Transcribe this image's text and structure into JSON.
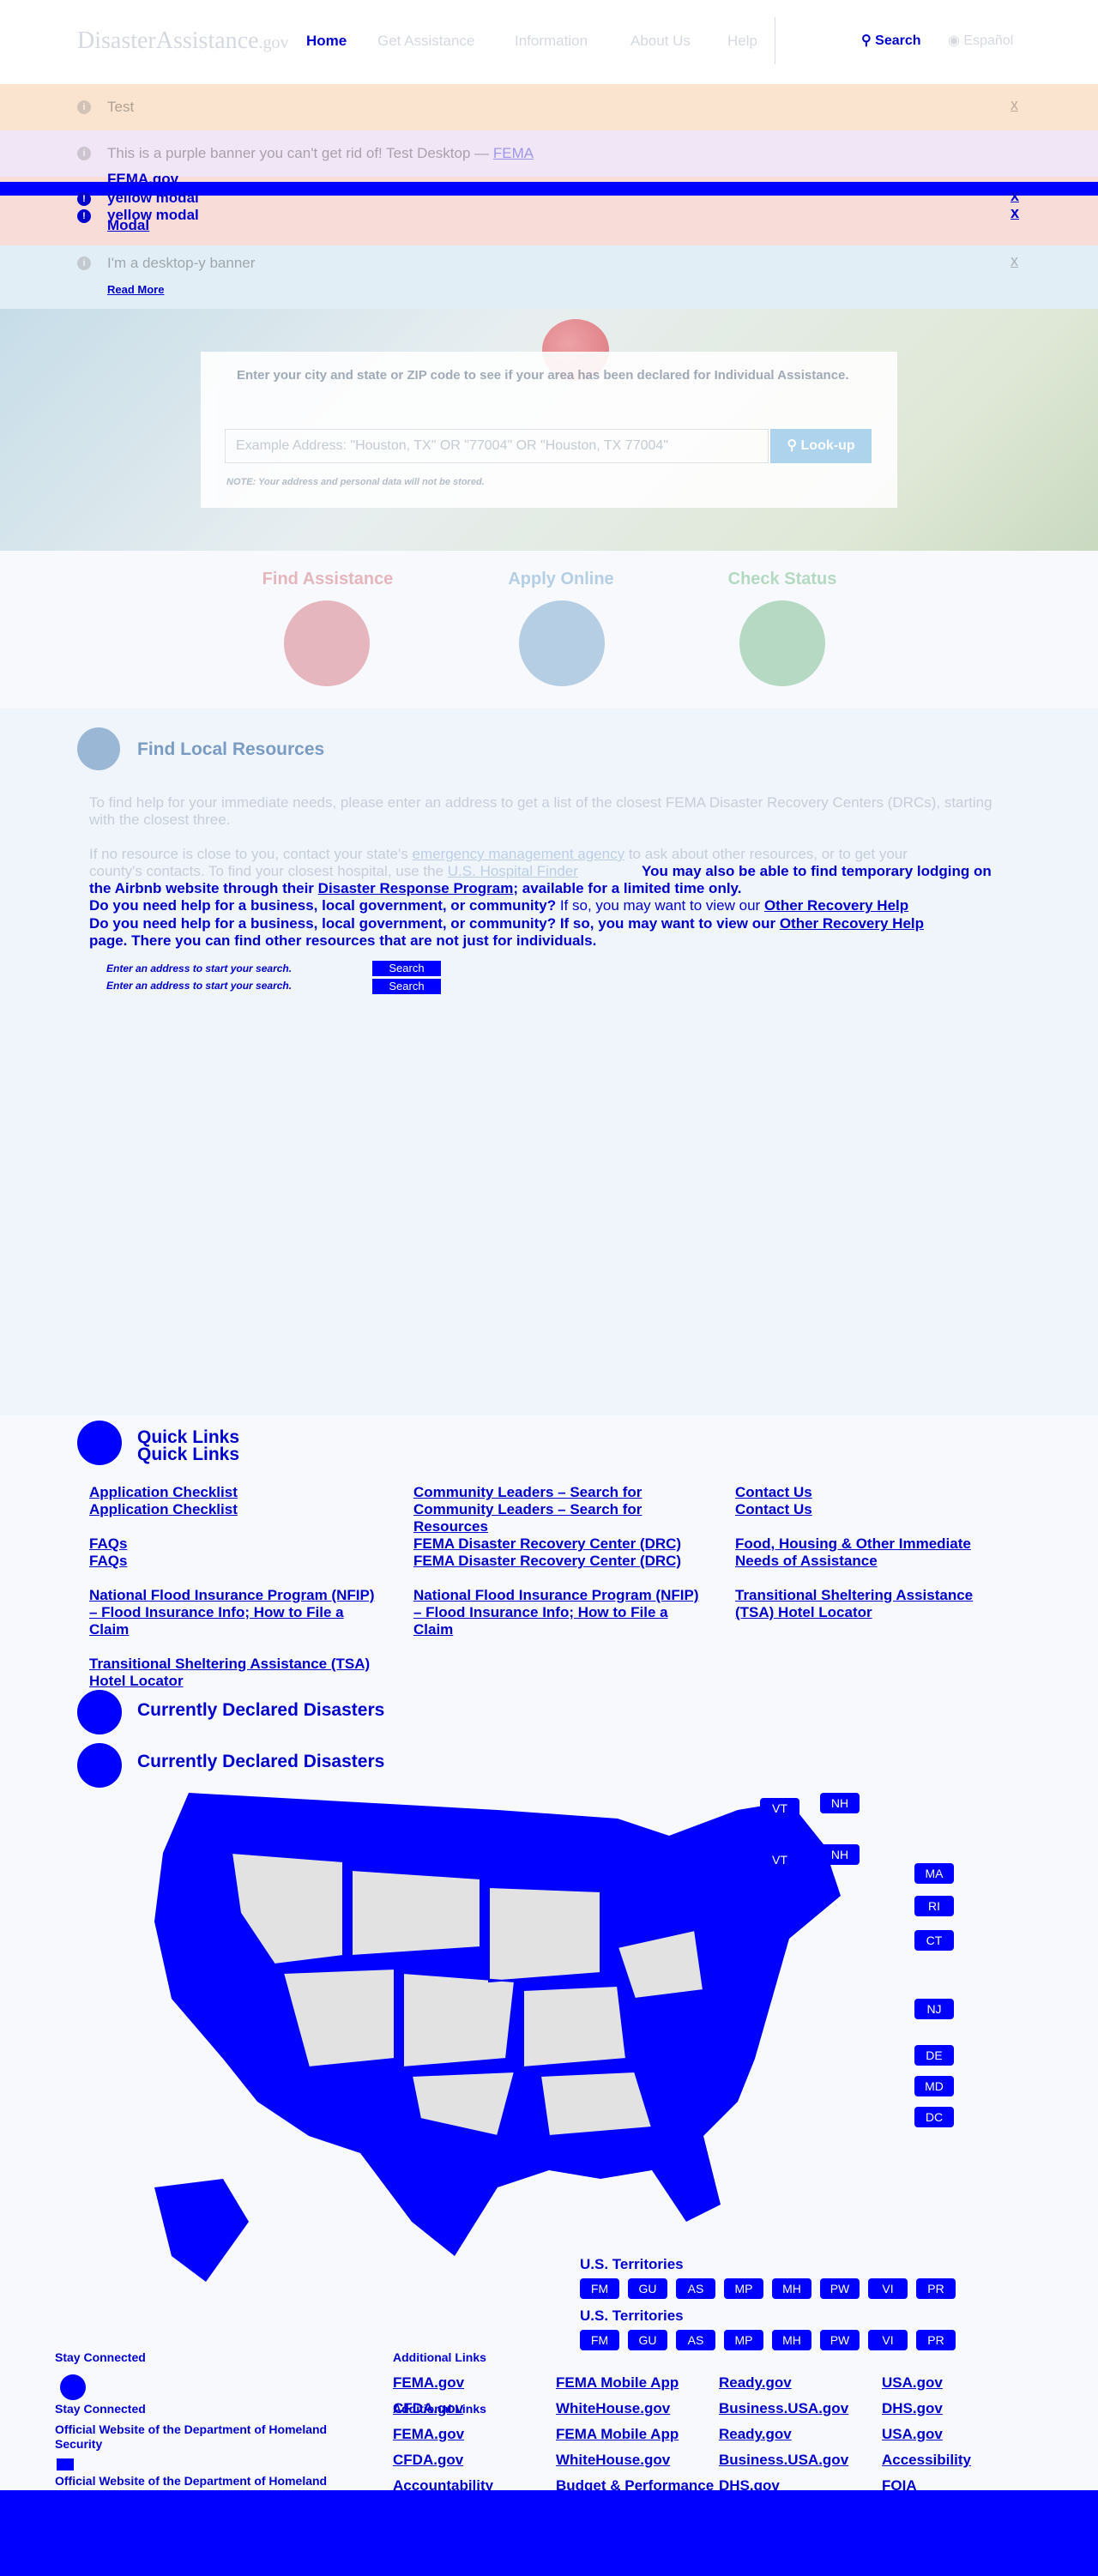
{
  "header": {
    "logo_main": "DisasterAssistance",
    "logo_gov": ".gov",
    "nav": [
      "Home",
      "Get Assistance",
      "Information",
      "About Us",
      "Help"
    ],
    "search": "Search",
    "espanol": "Español"
  },
  "banners": [
    {
      "text": "Test",
      "close": "x"
    },
    {
      "text": "This is a purple banner you can't get rid of! Test Desktop",
      "link": "FEMA"
    },
    {
      "text": "yellow modal",
      "close": "x"
    },
    {
      "text": "I'm a desktop-y banner",
      "close": "x"
    }
  ],
  "overlay": {
    "fema_gov": "FEMA.gov",
    "yellow_modal_1": "yellow modal",
    "yellow_modal_2": "yellow modal",
    "modal": "Modal",
    "x1": "x",
    "x2": "x",
    "read_more": "Read More"
  },
  "hero": {
    "prompt": "Enter your city and state or ZIP code to see if your area has been declared for Individual Assistance.",
    "placeholder": "Example Address: \"Houston, TX\" OR \"77004\" OR \"Houston, TX 77004\"",
    "button": "Look-up",
    "note": "NOTE: Your address and personal data will not be stored."
  },
  "actions": {
    "find": "Find Assistance",
    "apply": "Apply Online",
    "status": "Check Status"
  },
  "local": {
    "title": "Find Local Resources",
    "p1": "To find help for your immediate needs, please enter an address to get a list of the closest FEMA Disaster Recovery Centers (DRCs), starting with the closest three.",
    "p2_a": "If no resource is close to you, contact your state's",
    "p2_link": "emergency management agency",
    "p2_b": "to ask about other resources, or to get your",
    "p3_a": "county's contacts. To find your closest hospital, use the",
    "p3_link": "U.S. Hospital Finder",
    "p3_b": "You may also be able to find temporary lodging on",
    "p4_a": "the Airbnb website through their",
    "p4_link": "Disaster Response Program",
    "p4_b": "; available for a limited time only.",
    "p5_a": "Do you need help for a business, local government, or community?",
    "p5_b": "If so, you may want to view our",
    "p5_link": "Other Recovery Help",
    "p6_a": "Do you need help for a business, local government, or community? If so, you may want to view our",
    "p6_link": "Other Recovery Help",
    "p7": "page. There you can find other resources that are not just for individuals.",
    "search_hint_1": "Enter an address to start your search.",
    "search_hint_2": "Enter an address to start your search.",
    "search_btn_1": "Search",
    "search_btn_2": "Search"
  },
  "quick_links": {
    "title_1": "Quick Links",
    "title_2": "Quick Links",
    "col1": [
      "Application Checklist",
      "Application Checklist",
      "FAQs",
      "FAQs",
      "National Flood Insurance Program (NFIP) – Flood Insurance Info; How to File a Claim",
      "Transitional Sheltering Assistance (TSA) Hotel Locator"
    ],
    "col2": [
      "Community Leaders – Search for Community Leaders – Search for Resources",
      "FEMA Disaster Recovery Center (DRC)",
      "FEMA Disaster Recovery Center (DRC)",
      "National Flood Insurance Program (NFIP) – Flood Insurance Info; How to File a Claim"
    ],
    "col3": [
      "Contact Us",
      "Contact Us",
      "Food, Housing & Other Immediate Needs of Assistance",
      "Transitional Sheltering Assistance (TSA) Hotel Locator"
    ]
  },
  "declared": {
    "title_1": "Currently Declared Disasters",
    "title_2": "Currently Declared Disasters",
    "small_states": [
      "VT",
      "NH",
      "VT",
      "NH",
      "MA",
      "RI",
      "CT",
      "NJ",
      "DE",
      "MD",
      "DC"
    ],
    "territories_title_1": "U.S. Territories",
    "territories_title_2": "U.S. Territories",
    "territories": [
      "FM",
      "GU",
      "AS",
      "MP",
      "MH",
      "PW",
      "VI",
      "PR"
    ]
  },
  "footer": {
    "stay_connected_1": "Stay Connected",
    "stay_connected_2": "Stay Connected",
    "dhs_1": "Official Website of the Department of Homeland Security",
    "dhs_2": "Official Website of the Department of Homeland",
    "additional_links": "Additional Links",
    "additional_links_2": "Additional Links",
    "links_row1": [
      "FEMA.gov",
      "FEMA Mobile App",
      "Ready.gov",
      "USA.gov"
    ],
    "links_row2": [
      "CFDA.gov",
      "WhiteHouse.gov",
      "Business.USA.gov",
      "DHS.gov"
    ],
    "links_row3": [
      "FEMA.gov",
      "FEMA Mobile App",
      "Ready.gov",
      "USA.gov"
    ],
    "links_row4": [
      "CFDA.gov",
      "WhiteHouse.gov",
      "Business.USA.gov",
      "Accessibility"
    ],
    "links_row5": [
      "Accountability",
      "Budget & Performance",
      "DHS.gov",
      "FOIA"
    ]
  },
  "colors": {
    "overlay_blue": "#0000ff",
    "link_blue": "#0000cc"
  }
}
